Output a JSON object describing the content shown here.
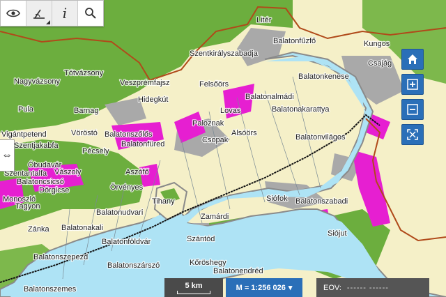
{
  "toolbar": {
    "tools": [
      {
        "icon": "eye-icon"
      },
      {
        "icon": "ruler-icon"
      },
      {
        "icon": "info-icon",
        "glyph": "i"
      },
      {
        "icon": "search-icon"
      }
    ]
  },
  "map_controls": [
    "home-icon",
    "zoom-in-icon",
    "zoom-out-icon",
    "fullscreen-icon"
  ],
  "scale": {
    "bar_label": "5 km",
    "ratio_label": "M = 1:256 026"
  },
  "coords": {
    "label": "EOV:",
    "value": "------ ------"
  },
  "colors": {
    "lake": "#aee3f5",
    "forest": "#6cae3e",
    "urban": "#a9a9a9",
    "protected": "#e61fd1",
    "boundary": "#b04a1a",
    "land": "#f5f0c8"
  },
  "places": [
    "Litér",
    "Balatonfűzfő",
    "Kungos",
    "Csajág",
    "Szentkirályszabadja",
    "Balatonkenese",
    "Balatonakarattya",
    "Tótvázsony",
    "Veszprémfajsz",
    "Nagyvázsony",
    "Felsőörs",
    "Balatonalmádi",
    "Hidegkút",
    "Pula",
    "Barnag",
    "Lovas",
    "Paloznak",
    "Alsóörs",
    "Balatonvilágos",
    "Vöröstó",
    "Vigántpetend",
    "Balatonszőlős",
    "Csopak",
    "Szentjakabfa",
    "Balatonfüred",
    "Pécsely",
    "Monoszló",
    "Óbudavár",
    "Szentantalfa",
    "Vászoly",
    "Balatoncsicsó",
    "Dörgicse",
    "Aszófő",
    "Örvényes",
    "Tagyon",
    "Tihany",
    "Siófok",
    "Balatonszabadi",
    "Balatonudvari",
    "Zánka",
    "Balatonakali",
    "Zamárdi",
    "Szántód",
    "Siójut",
    "Balatonföldvár",
    "Balatonszepezd",
    "Balatonszárszó",
    "Kőröshegy",
    "Balatonendréd",
    "Balatonszemes"
  ]
}
